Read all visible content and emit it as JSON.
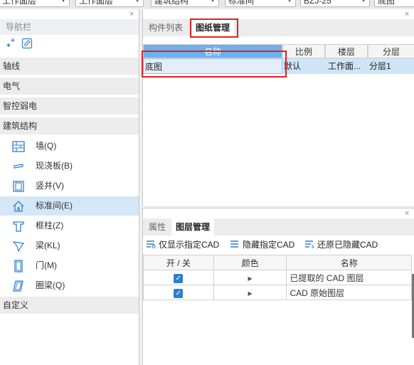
{
  "toolbar": {
    "dropdowns": [
      {
        "value": "工作面层"
      },
      {
        "value": "工作面层"
      },
      {
        "value": "建筑结构"
      },
      {
        "value": "标准间"
      },
      {
        "value": "BZJ-25"
      },
      {
        "value": "底图"
      }
    ]
  },
  "nav": {
    "close_glyph": "×",
    "title": "导航栏",
    "tools": {
      "add_icon": "add-sparkle-icon",
      "edit_icon": "edit-icon"
    },
    "sections": [
      {
        "label": "轴线"
      },
      {
        "label": "电气"
      },
      {
        "label": "智控弱电"
      },
      {
        "label": "建筑结构"
      }
    ],
    "items": [
      {
        "label": "墙(Q)",
        "icon": "wall-icon"
      },
      {
        "label": "现浇板(B)",
        "icon": "slab-icon"
      },
      {
        "label": "竖井(V)",
        "icon": "shaft-icon"
      },
      {
        "label": "标准间(E)",
        "icon": "house-icon",
        "selected": true
      },
      {
        "label": "框柱(Z)",
        "icon": "column-icon"
      },
      {
        "label": "梁(KL)",
        "icon": "beam-icon"
      },
      {
        "label": "门(M)",
        "icon": "door-icon"
      },
      {
        "label": "圈梁(Q)",
        "icon": "ring-beam-icon"
      }
    ],
    "custom_section": {
      "label": "自定义"
    }
  },
  "drawing_panel": {
    "close_glyph": "×",
    "tabs": [
      {
        "label": "构件列表"
      },
      {
        "label": "图纸管理",
        "active": true
      }
    ],
    "columns": [
      "名称",
      "比例",
      "楼层",
      "分层"
    ],
    "rows": [
      {
        "name": "底图",
        "scale": "默认",
        "floor": "工作面...",
        "layer": "分层1"
      }
    ]
  },
  "layer_panel": {
    "close_glyph": "×",
    "tabs": [
      {
        "label": "属性"
      },
      {
        "label": "图层管理",
        "active": true
      }
    ],
    "buttons": [
      {
        "label": "仅显示指定CAD",
        "icon": "show-only-icon"
      },
      {
        "label": "隐藏指定CAD",
        "icon": "hide-icon"
      },
      {
        "label": "还原已隐藏CAD",
        "icon": "restore-icon"
      }
    ],
    "columns": [
      "开 / 关",
      "颜色",
      "名称"
    ],
    "rows": [
      {
        "on": true,
        "name": "已提取的 CAD 图层"
      },
      {
        "on": true,
        "name": "CAD 原始图层"
      }
    ]
  },
  "colors": {
    "accent": "#2f7fd0",
    "highlight": "#e02020",
    "selection": "#d4e7f7"
  }
}
